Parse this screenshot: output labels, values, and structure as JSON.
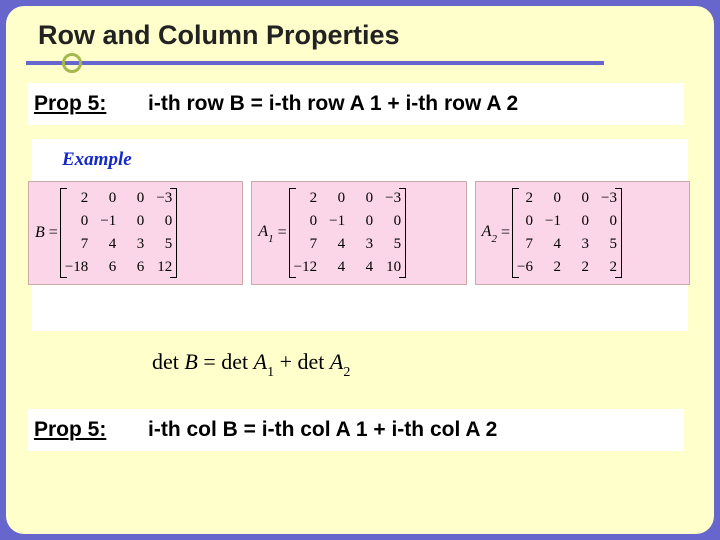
{
  "title": "Row and Column Properties",
  "prop_top": {
    "label": "Prop 5:",
    "text": "i-th row B = i-th row A 1 + i-th row A 2"
  },
  "prop_bottom": {
    "label": "Prop 5:",
    "text": "i-th col B = i-th col A 1 + i-th col A 2"
  },
  "example_label": "Example",
  "det_equation": {
    "pre": "det ",
    "B": "B",
    "mid1": " = det ",
    "A": "A",
    "s1": "1",
    "mid2": " + det ",
    "s2": "2"
  },
  "matrices": {
    "B": {
      "name": "B",
      "rows": [
        [
          "2",
          "0",
          "0",
          "−3"
        ],
        [
          "0",
          "−1",
          "0",
          "0"
        ],
        [
          "7",
          "4",
          "3",
          "5"
        ],
        [
          "−18",
          "6",
          "6",
          "12"
        ]
      ]
    },
    "A1": {
      "name": "A",
      "sub": "1",
      "rows": [
        [
          "2",
          "0",
          "0",
          "−3"
        ],
        [
          "0",
          "−1",
          "0",
          "0"
        ],
        [
          "7",
          "4",
          "3",
          "5"
        ],
        [
          "−12",
          "4",
          "4",
          "10"
        ]
      ]
    },
    "A2": {
      "name": "A",
      "sub": "2",
      "rows": [
        [
          "2",
          "0",
          "0",
          "−3"
        ],
        [
          "0",
          "−1",
          "0",
          "0"
        ],
        [
          "7",
          "4",
          "3",
          "5"
        ],
        [
          "−6",
          "2",
          "2",
          "2"
        ]
      ]
    }
  }
}
